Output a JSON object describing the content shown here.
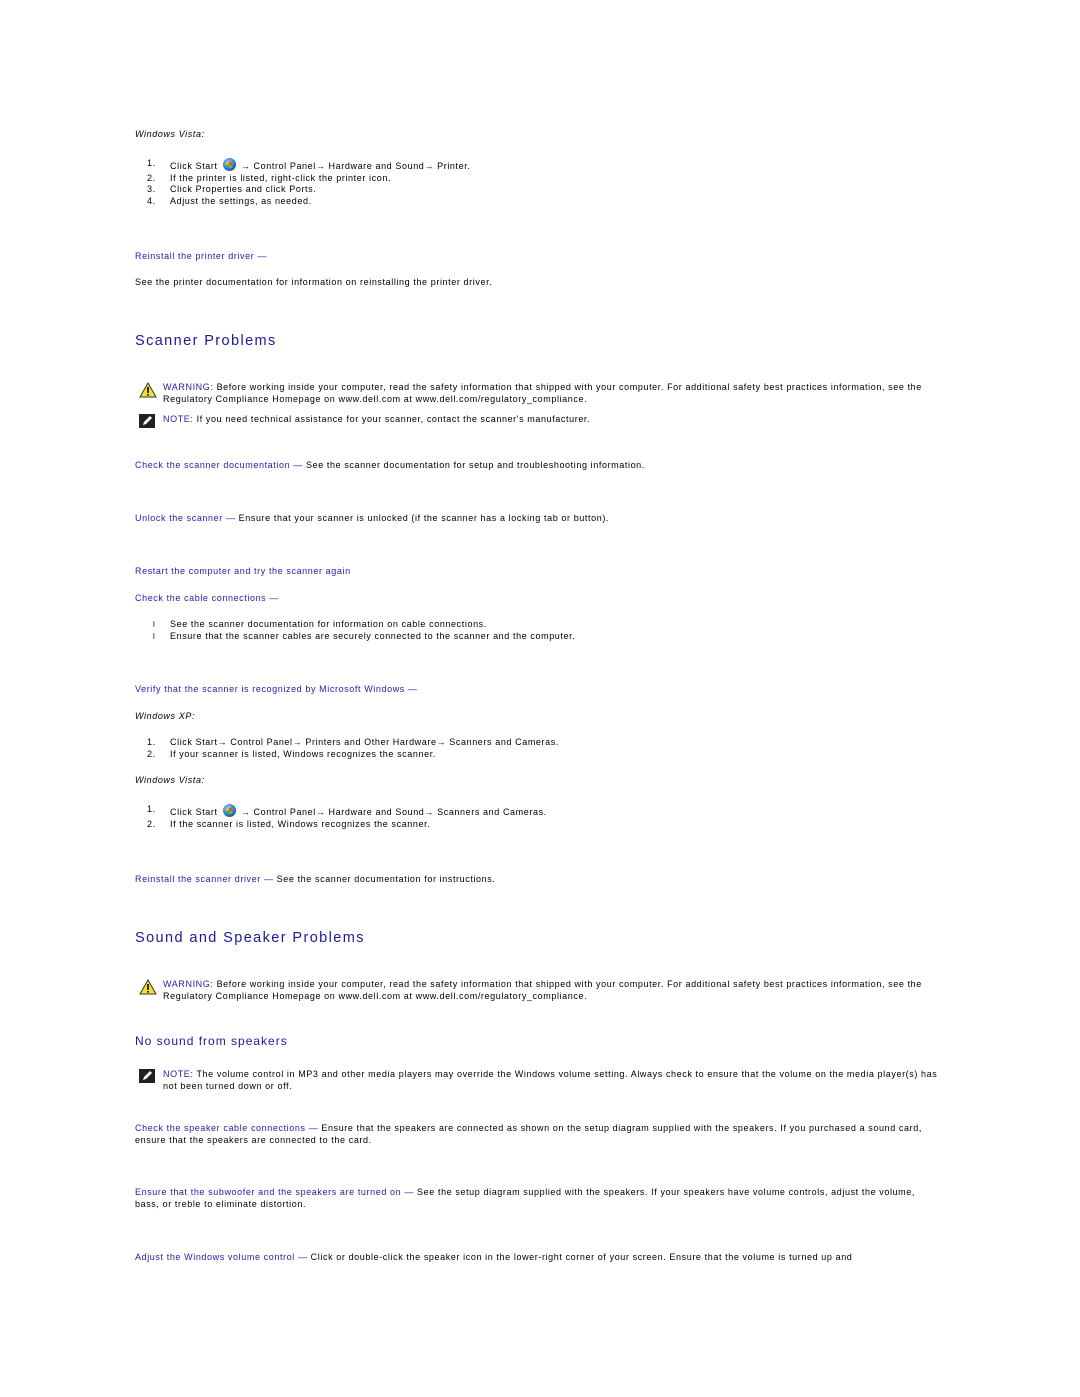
{
  "printer_vista": {
    "os_label": "Windows Vista:",
    "steps": [
      {
        "num": "1.",
        "pre": "Click Start",
        "post": "→ Control Panel→ Hardware and Sound→ Printer."
      },
      {
        "num": "2.",
        "text": "If the printer is listed, right-click the printer icon."
      },
      {
        "num": "3.",
        "text": "Click Properties and click Ports."
      },
      {
        "num": "4.",
        "text": "Adjust the settings, as needed."
      }
    ]
  },
  "reinstall_printer": {
    "link": "Reinstall the printer driver —",
    "text": "See the printer documentation for information on reinstalling the printer driver."
  },
  "scanner": {
    "title": "Scanner Problems",
    "warning": {
      "label": "WARNING:",
      "text": " Before working inside your computer, read the safety information that shipped with your computer. For additional safety best practices information, see the Regulatory Compliance Homepage on www.dell.com at www.dell.com/regulatory_compliance."
    },
    "note": {
      "label": "NOTE:",
      "text": " If you need technical assistance for your scanner, contact the scanner's manufacturer."
    },
    "check_doc": {
      "link": "Check the scanner documentation —",
      "text": " See the scanner documentation for setup and troubleshooting information."
    },
    "unlock": {
      "link": "Unlock the scanner —",
      "text": " Ensure that your scanner is unlocked (if the scanner has a locking tab or button)."
    },
    "restart": {
      "link": "Restart the computer and try the scanner again"
    },
    "cable": {
      "link": "Check the cable connections —",
      "bullets": [
        "See the scanner documentation for information on cable connections.",
        "Ensure that the scanner cables are securely connected to the scanner and the computer."
      ]
    },
    "verify": {
      "link": "Verify that the scanner is recognized by Microsoft Windows —",
      "xp_label": "Windows XP:",
      "xp_steps": [
        {
          "num": "1.",
          "text": "Click Start→ Control Panel→ Printers and Other Hardware→ Scanners and Cameras."
        },
        {
          "num": "2.",
          "text": "If your scanner is listed, Windows recognizes the scanner."
        }
      ],
      "vista_label": "Windows Vista:",
      "vista_steps": [
        {
          "num": "1.",
          "pre": "Click Start",
          "post": "→ Control Panel→ Hardware and Sound→ Scanners and Cameras."
        },
        {
          "num": "2.",
          "text": "If the scanner is listed, Windows recognizes the scanner."
        }
      ]
    },
    "reinstall": {
      "link": "Reinstall the scanner driver —",
      "text": " See the scanner documentation for instructions."
    }
  },
  "sound": {
    "title": "Sound and Speaker Problems",
    "warning": {
      "label": "WARNING:",
      "text": " Before working inside your computer, read the safety information that shipped with your computer. For additional safety best practices information, see the Regulatory Compliance Homepage on www.dell.com at www.dell.com/regulatory_compliance."
    },
    "subtitle": "No sound from speakers",
    "note": {
      "label": "NOTE:",
      "text": " The volume control in MP3 and other media players may override the Windows volume setting. Always check to ensure that the volume on the media player(s) has not been turned down or off."
    },
    "cable": {
      "link": "Check the speaker cable connections —",
      "text": " Ensure that the speakers are connected as shown on the setup diagram supplied with the speakers. If you purchased a sound card, ensure that the speakers are connected to the card."
    },
    "subwoofer": {
      "link": "Ensure that the subwoofer and the speakers are turned on —",
      "text": " See the setup diagram supplied with the speakers. If your speakers have volume controls, adjust the volume, bass, or treble to eliminate distortion."
    },
    "volume": {
      "link": "Adjust the Windows volume control —",
      "text": " Click or double-click the speaker icon in the lower-right corner of your screen. Ensure that the volume is turned up and"
    }
  }
}
